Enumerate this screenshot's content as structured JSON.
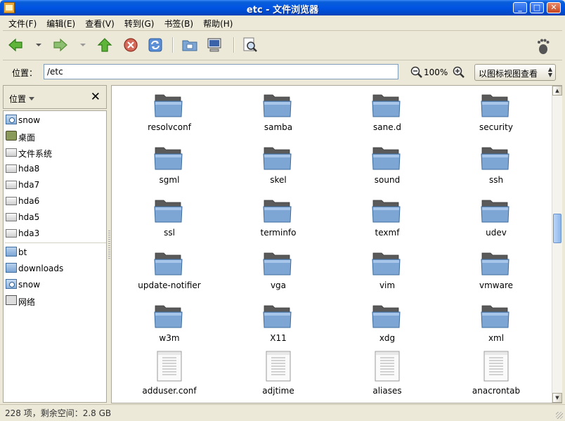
{
  "window": {
    "title": "etc - 文件浏览器",
    "minimize": "_",
    "maximize": "□",
    "close": "✕"
  },
  "menu": [
    "文件(F)",
    "编辑(E)",
    "查看(V)",
    "转到(G)",
    "书签(B)",
    "帮助(H)"
  ],
  "toolbar": {
    "icons": [
      "back-icon",
      "forward-icon",
      "up-icon",
      "stop-icon",
      "reload-icon",
      "home-folder-icon",
      "computer-icon",
      "search-icon",
      "gnome-foot-icon"
    ]
  },
  "location": {
    "label": "位置：",
    "path": "/etc",
    "zoom": "100%",
    "view_mode": "以图标视图查看"
  },
  "sidebar": {
    "header": "位置",
    "close": "✕",
    "places": [
      {
        "label": "snow",
        "icon": "home-icon"
      },
      {
        "label": "桌面",
        "icon": "desktop-icon"
      },
      {
        "label": "文件系统",
        "icon": "drive-icon"
      },
      {
        "label": "hda8",
        "icon": "drive-icon"
      },
      {
        "label": "hda7",
        "icon": "drive-icon"
      },
      {
        "label": "hda6",
        "icon": "drive-icon"
      },
      {
        "label": "hda5",
        "icon": "drive-icon"
      },
      {
        "label": "hda3",
        "icon": "drive-icon"
      }
    ],
    "bookmarks": [
      {
        "label": "bt",
        "icon": "folder-icon"
      },
      {
        "label": "downloads",
        "icon": "folder-icon"
      },
      {
        "label": "snow",
        "icon": "home-icon"
      },
      {
        "label": "网络",
        "icon": "network-icon"
      }
    ]
  },
  "files": [
    {
      "name": "resolvconf",
      "type": "folder"
    },
    {
      "name": "samba",
      "type": "folder"
    },
    {
      "name": "sane.d",
      "type": "folder"
    },
    {
      "name": "security",
      "type": "folder"
    },
    {
      "name": "sgml",
      "type": "folder"
    },
    {
      "name": "skel",
      "type": "folder"
    },
    {
      "name": "sound",
      "type": "folder"
    },
    {
      "name": "ssh",
      "type": "folder"
    },
    {
      "name": "ssl",
      "type": "folder"
    },
    {
      "name": "terminfo",
      "type": "folder"
    },
    {
      "name": "texmf",
      "type": "folder"
    },
    {
      "name": "udev",
      "type": "folder"
    },
    {
      "name": "update-notifier",
      "type": "folder"
    },
    {
      "name": "vga",
      "type": "folder"
    },
    {
      "name": "vim",
      "type": "folder"
    },
    {
      "name": "vmware",
      "type": "folder"
    },
    {
      "name": "w3m",
      "type": "folder"
    },
    {
      "name": "X11",
      "type": "folder"
    },
    {
      "name": "xdg",
      "type": "folder"
    },
    {
      "name": "xml",
      "type": "folder"
    },
    {
      "name": "adduser.conf",
      "type": "file"
    },
    {
      "name": "adjtime",
      "type": "file"
    },
    {
      "name": "aliases",
      "type": "file"
    },
    {
      "name": "anacrontab",
      "type": "file"
    }
  ],
  "status": "228 项，剩余空间：2.8 GB",
  "colors": {
    "titlebar": "#0054e3",
    "folder": "#7ea6d4",
    "scroll_thumb": "#8db6ea"
  }
}
